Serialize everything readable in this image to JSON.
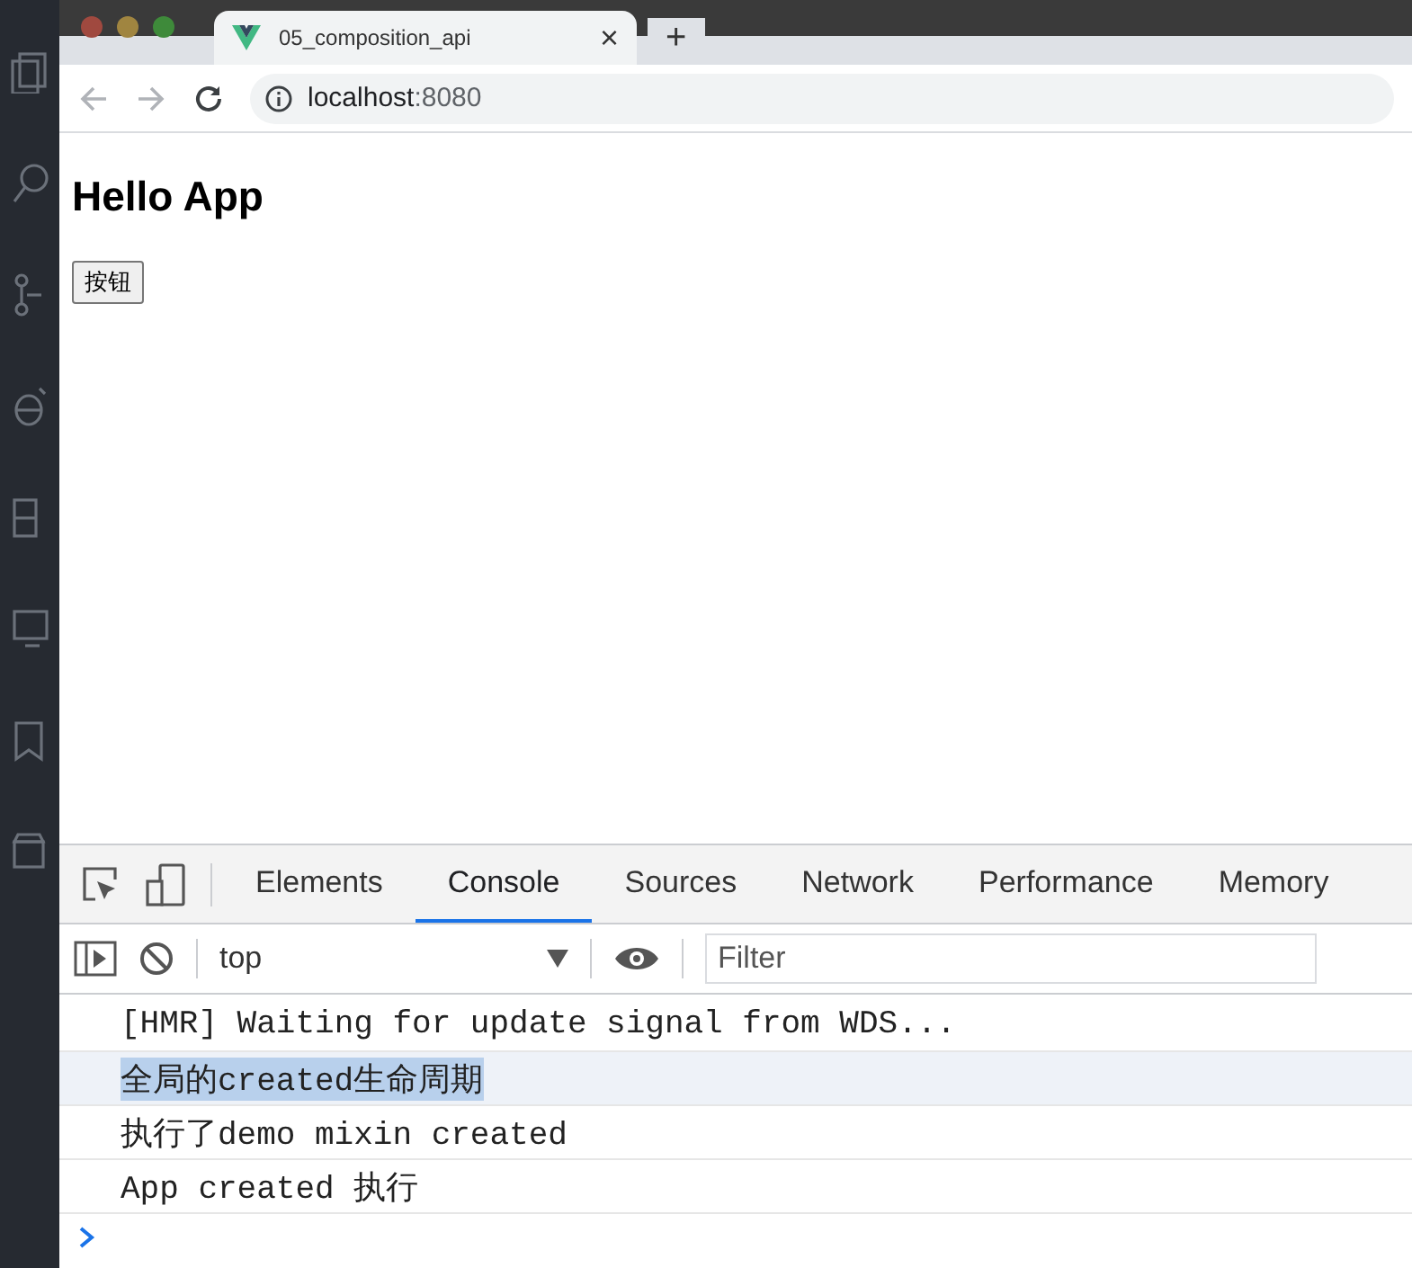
{
  "browser": {
    "tab": {
      "title": "05_composition_api",
      "close": "×"
    },
    "new_tab": "+",
    "address": {
      "host": "localhost",
      "port": ":8080"
    }
  },
  "page": {
    "heading": "Hello App",
    "button": "按钮"
  },
  "devtools": {
    "tabs": [
      {
        "label": "Elements",
        "selected": false
      },
      {
        "label": "Console",
        "selected": true
      },
      {
        "label": "Sources",
        "selected": false
      },
      {
        "label": "Network",
        "selected": false
      },
      {
        "label": "Performance",
        "selected": false
      },
      {
        "label": "Memory",
        "selected": false
      }
    ],
    "context": "top",
    "filter": {
      "placeholder": "Filter"
    },
    "messages": [
      {
        "text": "[HMR] Waiting for update signal from WDS...",
        "selected": false
      },
      {
        "text": "全局的created生命周期",
        "selected": true
      },
      {
        "text": "执行了demo mixin created",
        "selected": false
      },
      {
        "text": "App created 执行",
        "selected": false
      }
    ]
  }
}
